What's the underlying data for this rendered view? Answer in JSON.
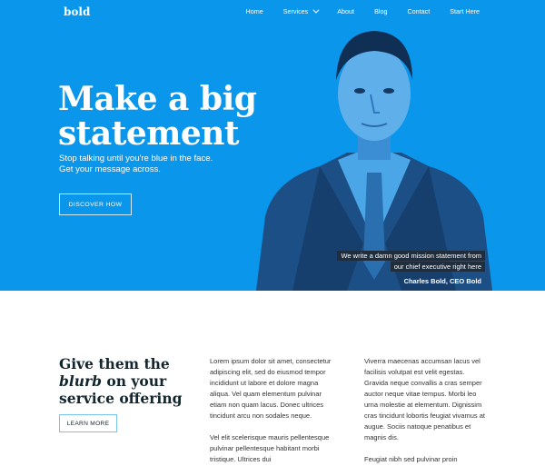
{
  "logo": "bold",
  "nav": {
    "items": [
      "Home",
      "Services",
      "About",
      "Blog",
      "Contact",
      "Start Here"
    ]
  },
  "hero": {
    "headline_line1": "Make a big",
    "headline_line2": "statement",
    "sub_line1": "Stop talking until you're blue in the face.",
    "sub_line2": "Get your message across.",
    "button": "DISCOVER HOW",
    "quote_line1": "We write a damn good mission statement from",
    "quote_line2": "our chief executive right here",
    "credit": "Charles Bold, CEO Bold",
    "color": "#0a96eb"
  },
  "section": {
    "title_line1": "Give them the",
    "title_em": "blurb",
    "title_line2_rest": " on your",
    "title_line3": "service offering",
    "button": "LEARN MORE",
    "col1_p1": "Lorem ipsum dolor sit amet, consectetur adipiscing elit, sed do eiusmod tempor incididunt ut labore et dolore magna aliqua. Vel quam elementum pulvinar etiam non quam lacus. Donec ultrices tincidunt arcu non sodales neque.",
    "col1_p2": "Vel elit scelerisque mauris pellentesque pulvinar pellentesque habitant morbi tristique. Ultrices dui",
    "col2_p1": "Viverra maecenas accumsan lacus vel facilisis volutpat est velit egestas. Gravida neque convallis a cras semper auctor neque vitae tempus. Morbi leo urna molestie at elementum. Dignissim cras tincidunt lobortis feugiat vivamus at augue. Sociis natoque penatibus et magnis dis.",
    "col2_p2": "Feugiat nibh sed pulvinar proin"
  }
}
